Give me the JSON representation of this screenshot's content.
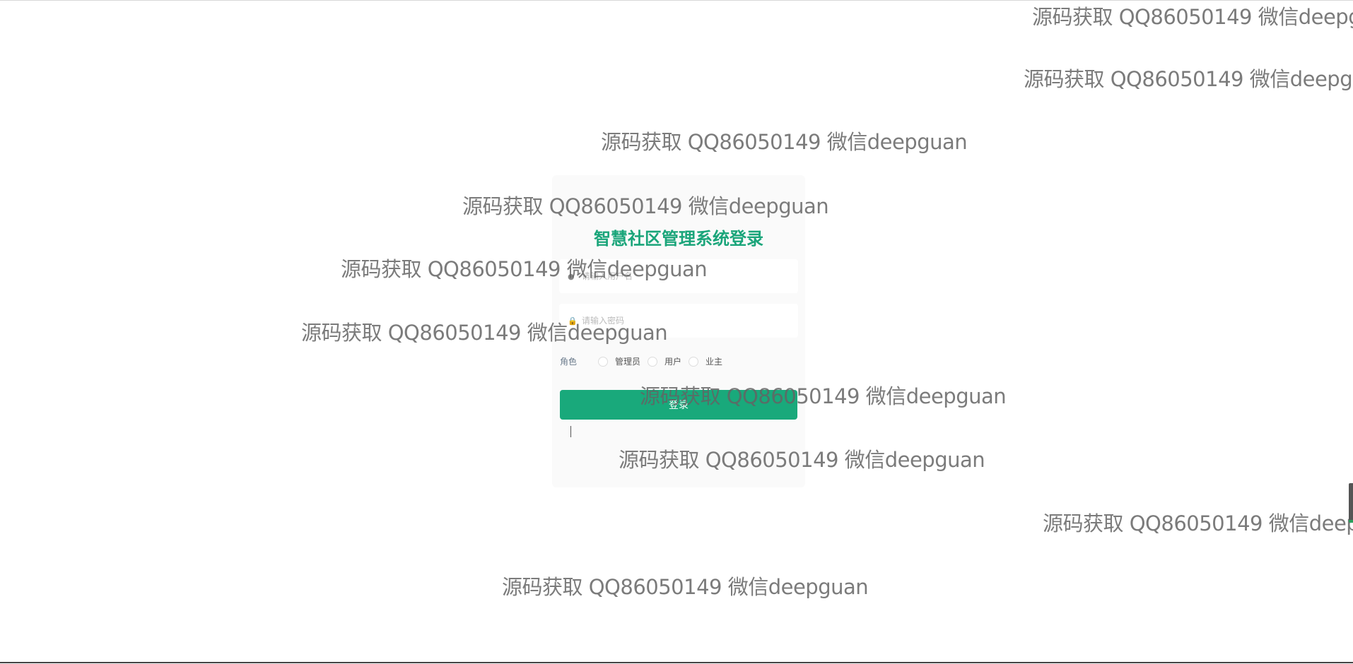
{
  "login": {
    "title": "智慧社区管理系统登录",
    "username_placeholder": "请输入用户名",
    "password_placeholder": "请输入密码",
    "role_label": "角色",
    "roles": [
      "管理员",
      "用户",
      "业主"
    ],
    "login_button": "登录"
  },
  "watermark": "源码获取 QQ86050149 微信deepguan",
  "colors": {
    "accent": "#19a97b",
    "title": "#1aa57a"
  }
}
